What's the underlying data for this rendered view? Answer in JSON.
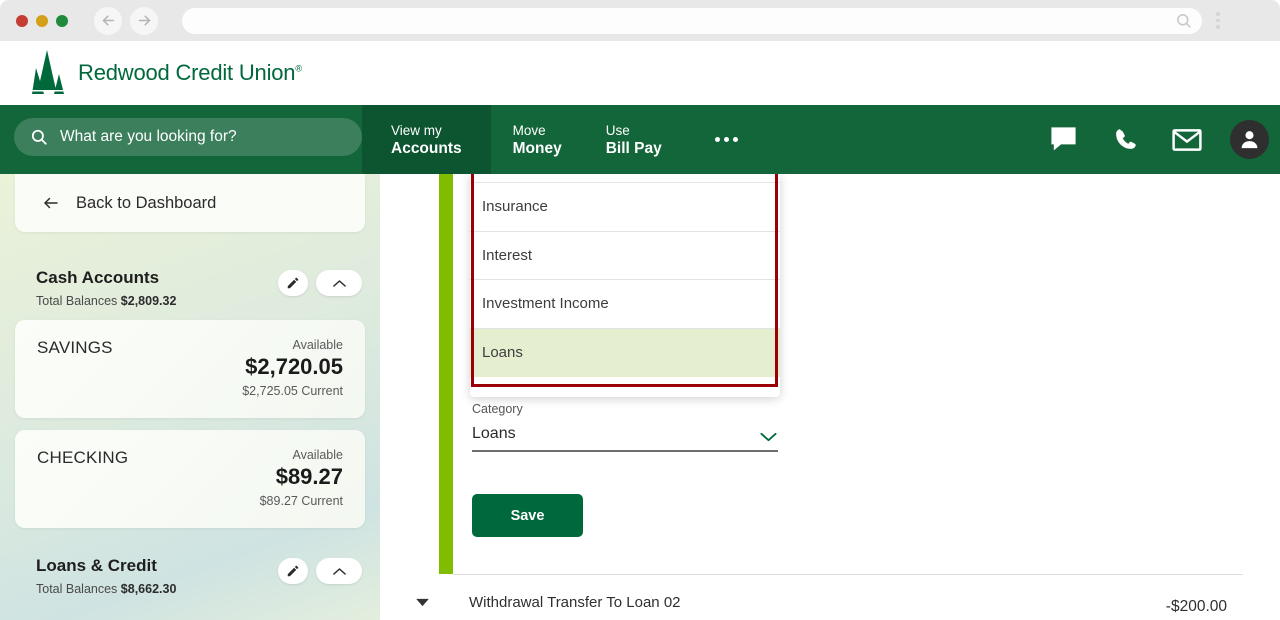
{
  "browser": {
    "traffic_lights": [
      "close",
      "minimize",
      "maximize"
    ],
    "back_icon": "arrow-left-icon",
    "forward_icon": "arrow-right-icon",
    "url_value": "",
    "url_search_icon": "search-icon",
    "menu_icon": "kebab-menu-icon"
  },
  "brand": {
    "logo_icon": "redwood-tree-logo",
    "name": "Redwood Credit Union",
    "trademark": "®",
    "color": "#00693C"
  },
  "nav": {
    "background": "#13663A",
    "search": {
      "icon": "search-icon",
      "placeholder": "What are you looking for?",
      "value": ""
    },
    "tabs": [
      {
        "line1": "View my",
        "line2": "Accounts",
        "active": true
      },
      {
        "line1": "Move",
        "line2": "Money",
        "active": false
      },
      {
        "line1": "Use",
        "line2": "Bill Pay",
        "active": false
      }
    ],
    "more_icon": "ellipsis-icon",
    "icons": [
      {
        "name": "chat-icon"
      },
      {
        "name": "phone-icon"
      },
      {
        "name": "mail-icon"
      },
      {
        "name": "user-avatar-icon"
      }
    ]
  },
  "sidebar": {
    "back": {
      "icon": "arrow-left-icon",
      "label": "Back to Dashboard"
    },
    "sections": [
      {
        "title": "Cash Accounts",
        "totals_label": "Total Balances",
        "totals_value": "$2,809.32",
        "edit_icon": "pencil-icon",
        "collapse_icon": "chevron-up-icon",
        "accounts": [
          {
            "name": "SAVINGS",
            "available_label": "Available",
            "available_amount": "$2,720.05",
            "current": "$2,725.05 Current"
          },
          {
            "name": "CHECKING",
            "available_label": "Available",
            "available_amount": "$89.27",
            "current": "$89.27 Current"
          }
        ]
      },
      {
        "title": "Loans & Credit",
        "totals_label": "Total Balances",
        "totals_value": "$8,662.30",
        "edit_icon": "pencil-icon",
        "collapse_icon": "chevron-up-icon"
      }
    ]
  },
  "main": {
    "accent_color": "#80BC00",
    "highlight_border_color": "#9C0006",
    "dropdown": {
      "open": true,
      "options": [
        {
          "label": "Insurance",
          "selected": false
        },
        {
          "label": "Interest",
          "selected": false
        },
        {
          "label": "Investment Income",
          "selected": false
        },
        {
          "label": "Loans",
          "selected": true
        }
      ]
    },
    "category_field": {
      "label": "Category",
      "value": "Loans",
      "chevron_icon": "chevron-down-icon"
    },
    "save_label": "Save",
    "transaction": {
      "expand_icon": "chevron-down-icon",
      "description": "Withdrawal Transfer To Loan 02",
      "amount": "-$200.00"
    }
  }
}
